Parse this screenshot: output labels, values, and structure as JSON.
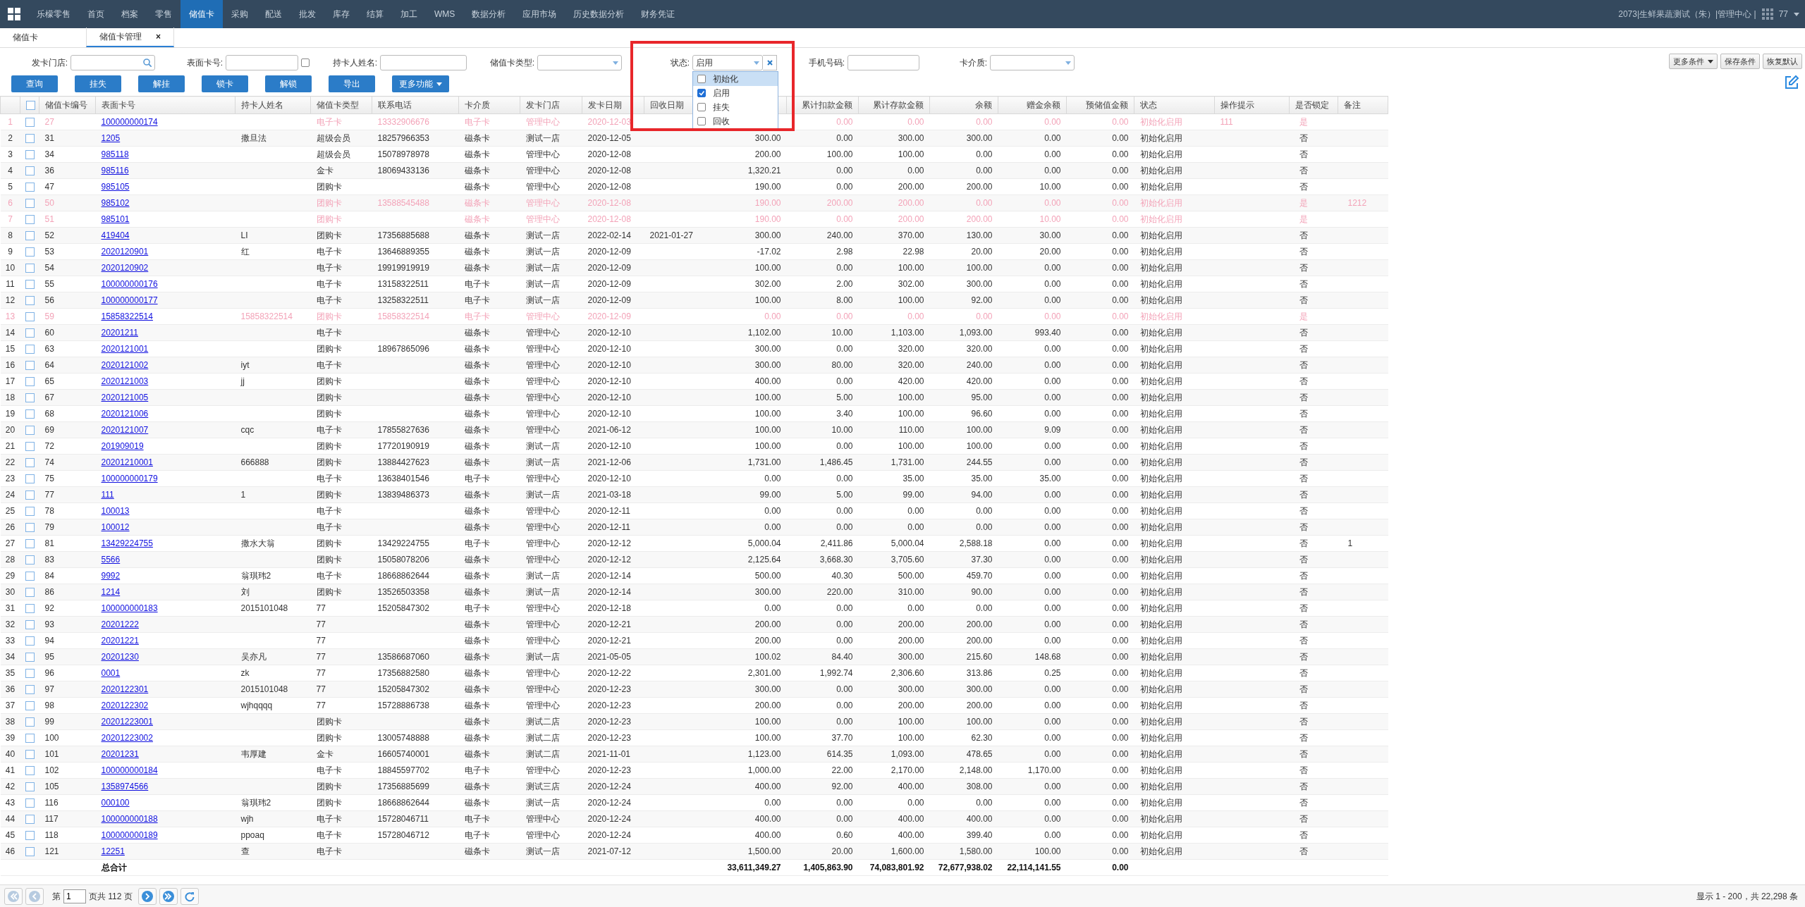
{
  "navbar": {
    "items": [
      {
        "label": "乐檬零售",
        "selected": false
      },
      {
        "label": "首页",
        "selected": false
      },
      {
        "label": "档案",
        "selected": false
      },
      {
        "label": "零售",
        "selected": false
      },
      {
        "label": "储值卡",
        "selected": true
      },
      {
        "label": "采购",
        "selected": false
      },
      {
        "label": "配送",
        "selected": false
      },
      {
        "label": "批发",
        "selected": false
      },
      {
        "label": "库存",
        "selected": false
      },
      {
        "label": "结算",
        "selected": false
      },
      {
        "label": "加工",
        "selected": false
      },
      {
        "label": "WMS",
        "selected": false
      },
      {
        "label": "数据分析",
        "selected": false
      },
      {
        "label": "应用市场",
        "selected": false
      },
      {
        "label": "历史数据分析",
        "selected": false
      },
      {
        "label": "财务凭证",
        "selected": false
      }
    ],
    "user_info": "2073|生鲜果蔬测试（朱）|管理中心 |",
    "user_count": "77"
  },
  "tabs": [
    {
      "label": "储值卡",
      "selected": false,
      "closable": false
    },
    {
      "label": "储值卡管理",
      "selected": true,
      "closable": true,
      "close": "×"
    }
  ],
  "filters": [
    {
      "kind": "search",
      "label": "发卡门店:"
    },
    {
      "kind": "text-check",
      "label": "表面卡号:",
      "checked": false
    },
    {
      "kind": "text",
      "label": "持卡人姓名:"
    },
    {
      "kind": "select",
      "label": "储值卡类型:"
    },
    {
      "kind": "select-clear",
      "label": "状态:",
      "value": "启用",
      "highlighted": true,
      "options": [
        {
          "label": "初始化",
          "checked": false,
          "hovered": true
        },
        {
          "label": "启用",
          "checked": true,
          "hovered": false
        },
        {
          "label": "挂失",
          "checked": false,
          "hovered": false
        },
        {
          "label": "回收",
          "checked": false,
          "hovered": false
        }
      ]
    },
    {
      "kind": "text",
      "label": "手机号码:"
    },
    {
      "kind": "select",
      "label": "卡介质:"
    }
  ],
  "right_buttons": [
    {
      "label": "更多条件",
      "caret": true
    },
    {
      "label": "保存条件",
      "caret": false
    },
    {
      "label": "恢复默认",
      "caret": false
    }
  ],
  "action_buttons": [
    {
      "label": "查询",
      "caret": false
    },
    {
      "label": "挂失",
      "caret": false
    },
    {
      "label": "解挂",
      "caret": false
    },
    {
      "label": "锁卡",
      "caret": false
    },
    {
      "label": "解锁",
      "caret": false
    },
    {
      "label": "导出",
      "caret": false
    },
    {
      "label": "更多功能",
      "caret": true
    }
  ],
  "table": {
    "header_checkbox": {
      "checked": false
    },
    "columns": [
      {
        "label": "储值卡编号",
        "kind": "text"
      },
      {
        "label": "表面卡号",
        "kind": "link"
      },
      {
        "label": "持卡人姓名",
        "kind": "text"
      },
      {
        "label": "储值卡类型",
        "kind": "text"
      },
      {
        "label": "联系电话",
        "kind": "text"
      },
      {
        "label": "卡介质",
        "kind": "text"
      },
      {
        "label": "发卡门店",
        "kind": "text"
      },
      {
        "label": "发卡日期",
        "kind": "text"
      },
      {
        "label": "回收日期",
        "kind": "text"
      },
      {
        "kind": "number"
      },
      {
        "label": "累计扣款金额",
        "kind": "number"
      },
      {
        "label": "累计存款金额",
        "kind": "number"
      },
      {
        "label": "余额",
        "kind": "number"
      },
      {
        "label": "赠金余额",
        "kind": "number"
      },
      {
        "label": "预储值金额",
        "kind": "number"
      },
      {
        "label": "状态",
        "kind": "text"
      },
      {
        "label": "操作提示",
        "kind": "text"
      },
      {
        "label": "是否锁定",
        "kind": "center"
      },
      {
        "label": "备注",
        "kind": "center"
      }
    ],
    "rows": [
      {
        "no": "1",
        "checked": false,
        "highlighted": true,
        "cells": {
          "card_id": "27",
          "card_no": "100000000174",
          "card_type": "电子卡",
          "phone": "13332906676",
          "medium": "电子卡",
          "store": "管理中心",
          "issue_date": "2020-12-03",
          "deducted": "0.00",
          "deposited": "0.00",
          "balance": "0.00",
          "gift_balance": "0.00",
          "prestored": "0.00",
          "status": "初始化启用",
          "hint": "111",
          "locked": "是"
        }
      },
      {
        "no": "2",
        "checked": false,
        "highlighted": false,
        "cells": {
          "card_id": "31",
          "card_no": "1205",
          "holder": "撒旦法",
          "card_type": "超级会员",
          "phone": "18257966353",
          "medium": "磁条卡",
          "store": "测试一店",
          "issue_date": "2020-12-05",
          "column_10": "300.00",
          "deducted": "0.00",
          "deposited": "300.00",
          "balance": "300.00",
          "gift_balance": "0.00",
          "prestored": "0.00",
          "status": "初始化启用",
          "locked": "否"
        }
      },
      {
        "no": "3",
        "checked": false,
        "highlighted": false,
        "cells": {
          "card_id": "34",
          "card_no": "985118",
          "card_type": "超级会员",
          "phone": "15078978978",
          "medium": "磁条卡",
          "store": "管理中心",
          "issue_date": "2020-12-08",
          "column_10": "200.00",
          "deducted": "100.00",
          "deposited": "100.00",
          "balance": "0.00",
          "gift_balance": "0.00",
          "prestored": "0.00",
          "status": "初始化启用",
          "locked": "否"
        }
      },
      {
        "no": "4",
        "checked": false,
        "highlighted": false,
        "cells": {
          "card_id": "36",
          "card_no": "985116",
          "card_type": "金卡",
          "phone": "18069433136",
          "medium": "磁条卡",
          "store": "管理中心",
          "issue_date": "2020-12-08",
          "column_10": "1,320.21",
          "deducted": "0.00",
          "deposited": "0.00",
          "balance": "0.00",
          "gift_balance": "0.00",
          "prestored": "0.00",
          "status": "初始化启用",
          "locked": "否"
        }
      },
      {
        "no": "5",
        "checked": false,
        "highlighted": false,
        "cells": {
          "card_id": "47",
          "card_no": "985105",
          "card_type": "团购卡",
          "medium": "磁条卡",
          "store": "管理中心",
          "issue_date": "2020-12-08",
          "column_10": "190.00",
          "deducted": "0.00",
          "deposited": "200.00",
          "balance": "200.00",
          "gift_balance": "10.00",
          "prestored": "0.00",
          "status": "初始化启用",
          "locked": "否"
        }
      },
      {
        "no": "6",
        "checked": false,
        "highlighted": true,
        "cells": {
          "card_id": "50",
          "card_no": "985102",
          "card_type": "团购卡",
          "phone": "13588545488",
          "medium": "磁条卡",
          "store": "管理中心",
          "issue_date": "2020-12-08",
          "column_10": "190.00",
          "deducted": "200.00",
          "deposited": "200.00",
          "balance": "0.00",
          "gift_balance": "0.00",
          "prestored": "0.00",
          "status": "初始化启用",
          "locked": "是",
          "note": "1212"
        }
      },
      {
        "no": "7",
        "checked": false,
        "highlighted": true,
        "cells": {
          "card_id": "51",
          "card_no": "985101",
          "card_type": "团购卡",
          "medium": "磁条卡",
          "store": "管理中心",
          "issue_date": "2020-12-08",
          "column_10": "190.00",
          "deducted": "0.00",
          "deposited": "200.00",
          "balance": "200.00",
          "gift_balance": "10.00",
          "prestored": "0.00",
          "status": "初始化启用",
          "locked": "是"
        }
      },
      {
        "no": "8",
        "checked": false,
        "highlighted": false,
        "cells": {
          "card_id": "52",
          "card_no": "419404",
          "holder": "LI",
          "card_type": "团购卡",
          "phone": "17356885688",
          "medium": "磁条卡",
          "store": "测试一店",
          "issue_date": "2022-02-14",
          "recycle_date": "2021-01-27",
          "column_10": "300.00",
          "deducted": "240.00",
          "deposited": "370.00",
          "balance": "130.00",
          "gift_balance": "30.00",
          "prestored": "0.00",
          "status": "初始化启用",
          "locked": "否"
        }
      },
      {
        "no": "9",
        "checked": false,
        "highlighted": false,
        "cells": {
          "card_id": "53",
          "card_no": "2020120901",
          "holder": "红",
          "card_type": "电子卡",
          "phone": "13646889355",
          "medium": "磁条卡",
          "store": "测试一店",
          "issue_date": "2020-12-09",
          "column_10": "-17.02",
          "deducted": "2.98",
          "deposited": "22.98",
          "balance": "20.00",
          "gift_balance": "20.00",
          "prestored": "0.00",
          "status": "初始化启用",
          "locked": "否"
        }
      },
      {
        "no": "10",
        "checked": false,
        "highlighted": false,
        "cells": {
          "card_id": "54",
          "card_no": "2020120902",
          "card_type": "电子卡",
          "phone": "19919919919",
          "medium": "磁条卡",
          "store": "测试一店",
          "issue_date": "2020-12-09",
          "column_10": "100.00",
          "deducted": "0.00",
          "deposited": "100.00",
          "balance": "100.00",
          "gift_balance": "0.00",
          "prestored": "0.00",
          "status": "初始化启用",
          "locked": "否"
        }
      },
      {
        "no": "11",
        "checked": false,
        "highlighted": false,
        "cells": {
          "card_id": "55",
          "card_no": "100000000176",
          "card_type": "电子卡",
          "phone": "13158322511",
          "medium": "电子卡",
          "store": "测试一店",
          "issue_date": "2020-12-09",
          "column_10": "302.00",
          "deducted": "2.00",
          "deposited": "302.00",
          "balance": "300.00",
          "gift_balance": "0.00",
          "prestored": "0.00",
          "status": "初始化启用",
          "locked": "否"
        }
      },
      {
        "no": "12",
        "checked": false,
        "highlighted": false,
        "cells": {
          "card_id": "56",
          "card_no": "100000000177",
          "card_type": "电子卡",
          "phone": "13258322511",
          "medium": "电子卡",
          "store": "测试一店",
          "issue_date": "2020-12-09",
          "column_10": "100.00",
          "deducted": "8.00",
          "deposited": "100.00",
          "balance": "92.00",
          "gift_balance": "0.00",
          "prestored": "0.00",
          "status": "初始化启用",
          "locked": "否"
        }
      },
      {
        "no": "13",
        "checked": false,
        "highlighted": true,
        "cells": {
          "card_id": "59",
          "card_no": "15858322514",
          "holder": "15858322514",
          "card_type": "团购卡",
          "phone": "15858322514",
          "medium": "电子卡",
          "store": "管理中心",
          "issue_date": "2020-12-09",
          "column_10": "0.00",
          "deducted": "0.00",
          "deposited": "0.00",
          "balance": "0.00",
          "gift_balance": "0.00",
          "prestored": "0.00",
          "status": "初始化启用",
          "locked": "是"
        }
      },
      {
        "no": "14",
        "checked": false,
        "highlighted": false,
        "cells": {
          "card_id": "60",
          "card_no": "20201211",
          "card_type": "电子卡",
          "medium": "磁条卡",
          "store": "管理中心",
          "issue_date": "2020-12-10",
          "column_10": "1,102.00",
          "deducted": "10.00",
          "deposited": "1,103.00",
          "balance": "1,093.00",
          "gift_balance": "993.40",
          "prestored": "0.00",
          "status": "初始化启用",
          "locked": "否"
        }
      },
      {
        "no": "15",
        "checked": false,
        "highlighted": false,
        "cells": {
          "card_id": "63",
          "card_no": "2020121001",
          "card_type": "团购卡",
          "phone": "18967865096",
          "medium": "磁条卡",
          "store": "管理中心",
          "issue_date": "2020-12-10",
          "column_10": "300.00",
          "deducted": "0.00",
          "deposited": "320.00",
          "balance": "320.00",
          "gift_balance": "0.00",
          "prestored": "0.00",
          "status": "初始化启用",
          "locked": "否"
        }
      },
      {
        "no": "16",
        "checked": false,
        "highlighted": false,
        "cells": {
          "card_id": "64",
          "card_no": "2020121002",
          "holder": "iyt",
          "card_type": "电子卡",
          "medium": "磁条卡",
          "store": "管理中心",
          "issue_date": "2020-12-10",
          "column_10": "300.00",
          "deducted": "80.00",
          "deposited": "320.00",
          "balance": "240.00",
          "gift_balance": "0.00",
          "prestored": "0.00",
          "status": "初始化启用",
          "locked": "否"
        }
      },
      {
        "no": "17",
        "checked": false,
        "highlighted": false,
        "cells": {
          "card_id": "65",
          "card_no": "2020121003",
          "holder": "jj",
          "card_type": "团购卡",
          "medium": "磁条卡",
          "store": "管理中心",
          "issue_date": "2020-12-10",
          "column_10": "400.00",
          "deducted": "0.00",
          "deposited": "420.00",
          "balance": "420.00",
          "gift_balance": "0.00",
          "prestored": "0.00",
          "status": "初始化启用",
          "locked": "否"
        }
      },
      {
        "no": "18",
        "checked": false,
        "highlighted": false,
        "cells": {
          "card_id": "67",
          "card_no": "2020121005",
          "card_type": "团购卡",
          "medium": "磁条卡",
          "store": "管理中心",
          "issue_date": "2020-12-10",
          "column_10": "100.00",
          "deducted": "5.00",
          "deposited": "100.00",
          "balance": "95.00",
          "gift_balance": "0.00",
          "prestored": "0.00",
          "status": "初始化启用",
          "locked": "否"
        }
      },
      {
        "no": "19",
        "checked": false,
        "highlighted": false,
        "cells": {
          "card_id": "68",
          "card_no": "2020121006",
          "card_type": "团购卡",
          "medium": "磁条卡",
          "store": "管理中心",
          "issue_date": "2020-12-10",
          "column_10": "100.00",
          "deducted": "3.40",
          "deposited": "100.00",
          "balance": "96.60",
          "gift_balance": "0.00",
          "prestored": "0.00",
          "status": "初始化启用",
          "locked": "否"
        }
      },
      {
        "no": "20",
        "checked": false,
        "highlighted": false,
        "cells": {
          "card_id": "69",
          "card_no": "2020121007",
          "holder": "cqc",
          "card_type": "电子卡",
          "phone": "17855827636",
          "medium": "磁条卡",
          "store": "管理中心",
          "issue_date": "2021-06-12",
          "column_10": "100.00",
          "deducted": "10.00",
          "deposited": "110.00",
          "balance": "100.00",
          "gift_balance": "9.09",
          "prestored": "0.00",
          "status": "初始化启用",
          "locked": "否"
        }
      },
      {
        "no": "21",
        "checked": false,
        "highlighted": false,
        "cells": {
          "card_id": "72",
          "card_no": "201909019",
          "card_type": "团购卡",
          "phone": "17720190919",
          "medium": "磁条卡",
          "store": "测试一店",
          "issue_date": "2020-12-10",
          "column_10": "100.00",
          "deducted": "0.00",
          "deposited": "100.00",
          "balance": "100.00",
          "gift_balance": "0.00",
          "prestored": "0.00",
          "status": "初始化启用",
          "locked": "否"
        }
      },
      {
        "no": "22",
        "checked": false,
        "highlighted": false,
        "cells": {
          "card_id": "74",
          "card_no": "20201210001",
          "holder": "666888",
          "card_type": "团购卡",
          "phone": "13884427623",
          "medium": "磁条卡",
          "store": "测试一店",
          "issue_date": "2021-12-06",
          "column_10": "1,731.00",
          "deducted": "1,486.45",
          "deposited": "1,731.00",
          "balance": "244.55",
          "gift_balance": "0.00",
          "prestored": "0.00",
          "status": "初始化启用",
          "locked": "否"
        }
      },
      {
        "no": "23",
        "checked": false,
        "highlighted": false,
        "cells": {
          "card_id": "75",
          "card_no": "100000000179",
          "card_type": "电子卡",
          "phone": "13638401546",
          "medium": "电子卡",
          "store": "管理中心",
          "issue_date": "2020-12-10",
          "column_10": "0.00",
          "deducted": "0.00",
          "deposited": "35.00",
          "balance": "35.00",
          "gift_balance": "35.00",
          "prestored": "0.00",
          "status": "初始化启用",
          "locked": "否"
        }
      },
      {
        "no": "24",
        "checked": false,
        "highlighted": false,
        "cells": {
          "card_id": "77",
          "card_no": "111",
          "holder": "1",
          "card_type": "团购卡",
          "phone": "13839486373",
          "medium": "磁条卡",
          "store": "测试一店",
          "issue_date": "2021-03-18",
          "column_10": "99.00",
          "deducted": "5.00",
          "deposited": "99.00",
          "balance": "94.00",
          "gift_balance": "0.00",
          "prestored": "0.00",
          "status": "初始化启用",
          "locked": "否"
        }
      },
      {
        "no": "25",
        "checked": false,
        "highlighted": false,
        "cells": {
          "card_id": "78",
          "card_no": "100013",
          "card_type": "电子卡",
          "medium": "磁条卡",
          "store": "管理中心",
          "issue_date": "2020-12-11",
          "column_10": "0.00",
          "deducted": "0.00",
          "deposited": "0.00",
          "balance": "0.00",
          "gift_balance": "0.00",
          "prestored": "0.00",
          "status": "初始化启用",
          "locked": "否"
        }
      },
      {
        "no": "26",
        "checked": false,
        "highlighted": false,
        "cells": {
          "card_id": "79",
          "card_no": "100012",
          "card_type": "电子卡",
          "medium": "磁条卡",
          "store": "管理中心",
          "issue_date": "2020-12-11",
          "column_10": "0.00",
          "deducted": "0.00",
          "deposited": "0.00",
          "balance": "0.00",
          "gift_balance": "0.00",
          "prestored": "0.00",
          "status": "初始化启用",
          "locked": "否"
        }
      },
      {
        "no": "27",
        "checked": false,
        "highlighted": false,
        "cells": {
          "card_id": "81",
          "card_no": "13429224755",
          "holder": "撒水大翁",
          "card_type": "团购卡",
          "phone": "13429224755",
          "medium": "电子卡",
          "store": "管理中心",
          "issue_date": "2020-12-12",
          "column_10": "5,000.04",
          "deducted": "2,411.86",
          "deposited": "5,000.04",
          "balance": "2,588.18",
          "gift_balance": "0.00",
          "prestored": "0.00",
          "status": "初始化启用",
          "locked": "否",
          "note": "1"
        }
      },
      {
        "no": "28",
        "checked": false,
        "highlighted": false,
        "cells": {
          "card_id": "83",
          "card_no": "5566",
          "card_type": "团购卡",
          "phone": "15058078206",
          "medium": "磁条卡",
          "store": "管理中心",
          "issue_date": "2020-12-12",
          "column_10": "2,125.64",
          "deducted": "3,668.30",
          "deposited": "3,705.60",
          "balance": "37.30",
          "gift_balance": "0.00",
          "prestored": "0.00",
          "status": "初始化启用",
          "locked": "否"
        }
      },
      {
        "no": "29",
        "checked": false,
        "highlighted": false,
        "cells": {
          "card_id": "84",
          "card_no": "9992",
          "holder": "翁琪玮2",
          "card_type": "电子卡",
          "phone": "18668862644",
          "medium": "磁条卡",
          "store": "测试一店",
          "issue_date": "2020-12-14",
          "column_10": "500.00",
          "deducted": "40.30",
          "deposited": "500.00",
          "balance": "459.70",
          "gift_balance": "0.00",
          "prestored": "0.00",
          "status": "初始化启用",
          "locked": "否"
        }
      },
      {
        "no": "30",
        "checked": false,
        "highlighted": false,
        "cells": {
          "card_id": "86",
          "card_no": "1214",
          "holder": "刘",
          "card_type": "团购卡",
          "phone": "13526503358",
          "medium": "磁条卡",
          "store": "测试一店",
          "issue_date": "2020-12-14",
          "column_10": "300.00",
          "deducted": "220.00",
          "deposited": "310.00",
          "balance": "90.00",
          "gift_balance": "0.00",
          "prestored": "0.00",
          "status": "初始化启用",
          "locked": "否"
        }
      },
      {
        "no": "31",
        "checked": false,
        "highlighted": false,
        "cells": {
          "card_id": "92",
          "card_no": "100000000183",
          "holder": "2015101048",
          "card_type": "77",
          "phone": "15205847302",
          "medium": "电子卡",
          "store": "管理中心",
          "issue_date": "2020-12-18",
          "column_10": "0.00",
          "deducted": "0.00",
          "deposited": "0.00",
          "balance": "0.00",
          "gift_balance": "0.00",
          "prestored": "0.00",
          "status": "初始化启用",
          "locked": "否"
        }
      },
      {
        "no": "32",
        "checked": false,
        "highlighted": false,
        "cells": {
          "card_id": "93",
          "card_no": "20201222",
          "card_type": "77",
          "medium": "磁条卡",
          "store": "管理中心",
          "issue_date": "2020-12-21",
          "column_10": "200.00",
          "deducted": "0.00",
          "deposited": "200.00",
          "balance": "200.00",
          "gift_balance": "0.00",
          "prestored": "0.00",
          "status": "初始化启用",
          "locked": "否"
        }
      },
      {
        "no": "33",
        "checked": false,
        "highlighted": false,
        "cells": {
          "card_id": "94",
          "card_no": "20201221",
          "card_type": "77",
          "medium": "磁条卡",
          "store": "管理中心",
          "issue_date": "2020-12-21",
          "column_10": "200.00",
          "deducted": "0.00",
          "deposited": "200.00",
          "balance": "200.00",
          "gift_balance": "0.00",
          "prestored": "0.00",
          "status": "初始化启用",
          "locked": "否"
        }
      },
      {
        "no": "34",
        "checked": false,
        "highlighted": false,
        "cells": {
          "card_id": "95",
          "card_no": "20201230",
          "holder": "吴亦凡",
          "card_type": "77",
          "phone": "13586687060",
          "medium": "磁条卡",
          "store": "测试一店",
          "issue_date": "2021-05-05",
          "column_10": "100.02",
          "deducted": "84.40",
          "deposited": "300.00",
          "balance": "215.60",
          "gift_balance": "148.68",
          "prestored": "0.00",
          "status": "初始化启用",
          "locked": "否"
        }
      },
      {
        "no": "35",
        "checked": false,
        "highlighted": false,
        "cells": {
          "card_id": "96",
          "card_no": "0001",
          "holder": "zk",
          "card_type": "77",
          "phone": "17356882580",
          "medium": "磁条卡",
          "store": "管理中心",
          "issue_date": "2020-12-22",
          "column_10": "2,301.00",
          "deducted": "1,992.74",
          "deposited": "2,306.60",
          "balance": "313.86",
          "gift_balance": "0.25",
          "prestored": "0.00",
          "status": "初始化启用",
          "locked": "否"
        }
      },
      {
        "no": "36",
        "checked": false,
        "highlighted": false,
        "cells": {
          "card_id": "97",
          "card_no": "2020122301",
          "holder": "2015101048",
          "card_type": "77",
          "phone": "15205847302",
          "medium": "磁条卡",
          "store": "管理中心",
          "issue_date": "2020-12-23",
          "column_10": "300.00",
          "deducted": "0.00",
          "deposited": "300.00",
          "balance": "300.00",
          "gift_balance": "0.00",
          "prestored": "0.00",
          "status": "初始化启用",
          "locked": "否"
        }
      },
      {
        "no": "37",
        "checked": false,
        "highlighted": false,
        "cells": {
          "card_id": "98",
          "card_no": "2020122302",
          "holder": "wjhqqqq",
          "card_type": "77",
          "phone": "15728886738",
          "medium": "磁条卡",
          "store": "管理中心",
          "issue_date": "2020-12-23",
          "column_10": "200.00",
          "deducted": "0.00",
          "deposited": "200.00",
          "balance": "200.00",
          "gift_balance": "0.00",
          "prestored": "0.00",
          "status": "初始化启用",
          "locked": "否"
        }
      },
      {
        "no": "38",
        "checked": false,
        "highlighted": false,
        "cells": {
          "card_id": "99",
          "card_no": "20201223001",
          "card_type": "团购卡",
          "medium": "磁条卡",
          "store": "测试二店",
          "issue_date": "2020-12-23",
          "column_10": "100.00",
          "deducted": "0.00",
          "deposited": "100.00",
          "balance": "100.00",
          "gift_balance": "0.00",
          "prestored": "0.00",
          "status": "初始化启用",
          "locked": "否"
        }
      },
      {
        "no": "39",
        "checked": false,
        "highlighted": false,
        "cells": {
          "card_id": "100",
          "card_no": "20201223002",
          "card_type": "团购卡",
          "phone": "13005748888",
          "medium": "磁条卡",
          "store": "测试二店",
          "issue_date": "2020-12-23",
          "column_10": "100.00",
          "deducted": "37.70",
          "deposited": "100.00",
          "balance": "62.30",
          "gift_balance": "0.00",
          "prestored": "0.00",
          "status": "初始化启用",
          "locked": "否"
        }
      },
      {
        "no": "40",
        "checked": false,
        "highlighted": false,
        "cells": {
          "card_id": "101",
          "card_no": "20201231",
          "holder": "韦厚建",
          "card_type": "金卡",
          "phone": "16605740001",
          "medium": "磁条卡",
          "store": "测试二店",
          "issue_date": "2021-11-01",
          "column_10": "1,123.00",
          "deducted": "614.35",
          "deposited": "1,093.00",
          "balance": "478.65",
          "gift_balance": "0.00",
          "prestored": "0.00",
          "status": "初始化启用",
          "locked": "否"
        }
      },
      {
        "no": "41",
        "checked": false,
        "highlighted": false,
        "cells": {
          "card_id": "102",
          "card_no": "100000000184",
          "card_type": "电子卡",
          "phone": "18845597702",
          "medium": "电子卡",
          "store": "管理中心",
          "issue_date": "2020-12-23",
          "column_10": "1,000.00",
          "deducted": "22.00",
          "deposited": "2,170.00",
          "balance": "2,148.00",
          "gift_balance": "1,170.00",
          "prestored": "0.00",
          "status": "初始化启用",
          "locked": "否"
        }
      },
      {
        "no": "42",
        "checked": false,
        "highlighted": false,
        "cells": {
          "card_id": "105",
          "card_no": "1358974566",
          "card_type": "团购卡",
          "phone": "17356885699",
          "medium": "磁条卡",
          "store": "测试三店",
          "issue_date": "2020-12-24",
          "column_10": "400.00",
          "deducted": "92.00",
          "deposited": "400.00",
          "balance": "308.00",
          "gift_balance": "0.00",
          "prestored": "0.00",
          "status": "初始化启用",
          "locked": "否"
        }
      },
      {
        "no": "43",
        "checked": false,
        "highlighted": false,
        "cells": {
          "card_id": "116",
          "card_no": "000100",
          "holder": "翁琪玮2",
          "card_type": "团购卡",
          "phone": "18668862644",
          "medium": "磁条卡",
          "store": "测试一店",
          "issue_date": "2020-12-24",
          "column_10": "0.00",
          "deducted": "0.00",
          "deposited": "0.00",
          "balance": "0.00",
          "gift_balance": "0.00",
          "prestored": "0.00",
          "status": "初始化启用",
          "locked": "否"
        }
      },
      {
        "no": "44",
        "checked": false,
        "highlighted": false,
        "cells": {
          "card_id": "117",
          "card_no": "100000000188",
          "holder": "wjh",
          "card_type": "电子卡",
          "phone": "15728046711",
          "medium": "电子卡",
          "store": "管理中心",
          "issue_date": "2020-12-24",
          "column_10": "400.00",
          "deducted": "0.00",
          "deposited": "400.00",
          "balance": "400.00",
          "gift_balance": "0.00",
          "prestored": "0.00",
          "status": "初始化启用",
          "locked": "否"
        }
      },
      {
        "no": "45",
        "checked": false,
        "highlighted": false,
        "cells": {
          "card_id": "118",
          "card_no": "100000000189",
          "holder": "ppoaq",
          "card_type": "电子卡",
          "phone": "15728046712",
          "medium": "电子卡",
          "store": "管理中心",
          "issue_date": "2020-12-24",
          "column_10": "400.00",
          "deducted": "0.60",
          "deposited": "400.00",
          "balance": "399.40",
          "gift_balance": "0.00",
          "prestored": "0.00",
          "status": "初始化启用",
          "locked": "否"
        }
      },
      {
        "no": "46",
        "checked": false,
        "highlighted": false,
        "cells": {
          "card_id": "121",
          "card_no": "12251",
          "holder": "查",
          "card_type": "电子卡",
          "medium": "磁条卡",
          "store": "测试一店",
          "issue_date": "2021-07-12",
          "column_10": "1,500.00",
          "deducted": "20.00",
          "deposited": "1,600.00",
          "balance": "1,580.00",
          "gift_balance": "100.00",
          "prestored": "0.00",
          "status": "初始化启用",
          "locked": "否"
        }
      }
    ],
    "totals": {
      "label": "总合计",
      "cells": {
        "column_10": "33,611,349.27",
        "deducted": "1,405,863.90",
        "deposited": "74,083,801.92",
        "balance": "72,677,938.02",
        "gift_balance": "22,114,141.55",
        "prestored": "0.00"
      }
    }
  },
  "pager": {
    "buttons_before": [
      {
        "kind": "first",
        "disabled": true
      },
      {
        "kind": "prev",
        "disabled": true
      }
    ],
    "page_prefix": "第",
    "page": "1",
    "page_suffix": "页共 112 页",
    "buttons_after": [
      {
        "kind": "next",
        "disabled": false
      },
      {
        "kind": "last",
        "disabled": false
      },
      {
        "kind": "refresh",
        "disabled": false
      }
    ],
    "summary": "显示 1 - 200，共 22,298 条"
  }
}
